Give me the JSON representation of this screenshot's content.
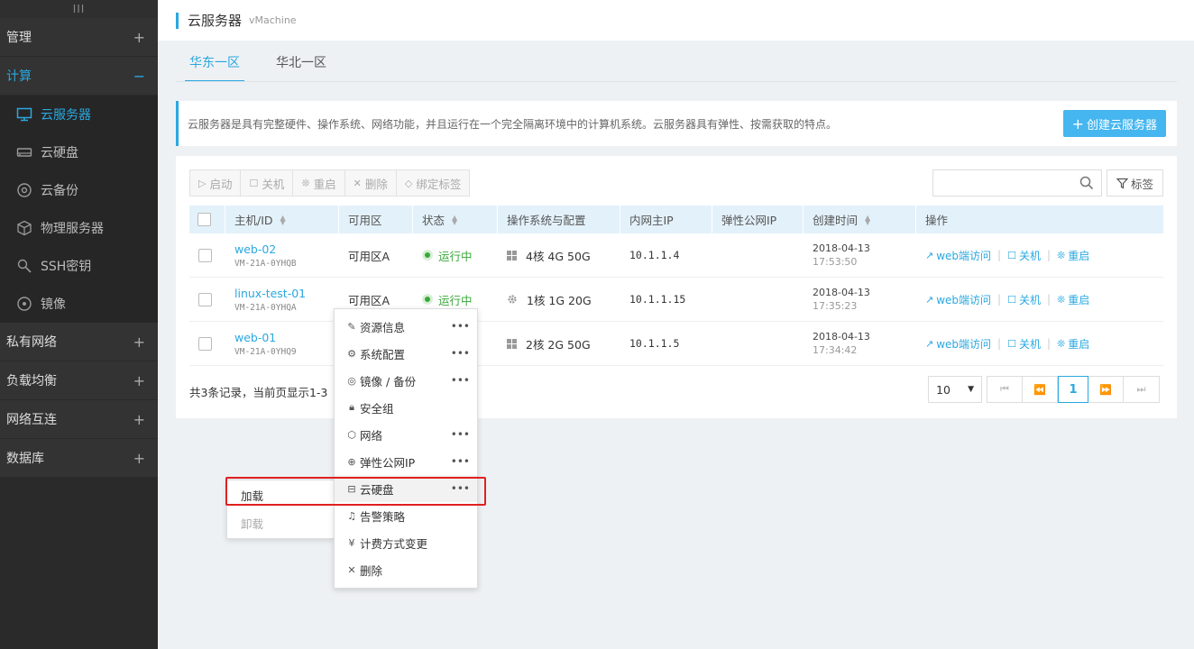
{
  "sidebar": {
    "handle": "III",
    "groups": [
      {
        "label": "管理",
        "toggle": "+"
      },
      {
        "label": "计算",
        "toggle": "−"
      },
      {
        "label": "私有网络",
        "toggle": "+"
      },
      {
        "label": "负载均衡",
        "toggle": "+"
      },
      {
        "label": "网络互连",
        "toggle": "+"
      },
      {
        "label": "数据库",
        "toggle": "+"
      }
    ],
    "compute_items": [
      {
        "label": "云服务器",
        "icon": "monitor-icon"
      },
      {
        "label": "云硬盘",
        "icon": "disk-icon"
      },
      {
        "label": "云备份",
        "icon": "backup-icon"
      },
      {
        "label": "物理服务器",
        "icon": "cube-icon"
      },
      {
        "label": "SSH密钥",
        "icon": "key-icon"
      },
      {
        "label": "镜像",
        "icon": "image-icon"
      }
    ]
  },
  "header": {
    "title": "云服务器",
    "subtitle": "vMachine"
  },
  "tabs": [
    {
      "label": "华东一区"
    },
    {
      "label": "华北一区"
    }
  ],
  "notice": {
    "text": "云服务器是具有完整硬件、操作系统、网络功能，并且运行在一个完全隔离环境中的计算机系统。云服务器具有弹性、按需获取的特点。",
    "create_button": "创建云服务器"
  },
  "toolbar": {
    "start": "启动",
    "stop": "关机",
    "restart": "重启",
    "delete": "删除",
    "bind_tag": "绑定标签",
    "tag_button": "标签"
  },
  "table": {
    "headers": {
      "host": "主机/ID",
      "zone": "可用区",
      "status": "状态",
      "os": "操作系统与配置",
      "private_ip": "内网主IP",
      "public_ip": "弹性公网IP",
      "created": "创建时间",
      "actions": "操作"
    },
    "rows": [
      {
        "name": "web-02",
        "id": "VM-21A-0YHQB",
        "zone": "可用区A",
        "status": "运行中",
        "os_icon": "windows-icon",
        "config": "4核 4G 50G",
        "ip": "10.1.1.4",
        "date": "2018-04-13",
        "time": "17:53:50"
      },
      {
        "name": "linux-test-01",
        "id": "VM-21A-0YHQA",
        "zone": "可用区A",
        "status": "运行中",
        "os_icon": "linux-gear-icon",
        "config": "1核 1G 20G",
        "ip": "10.1.1.15",
        "date": "2018-04-13",
        "time": "17:35:23"
      },
      {
        "name": "web-01",
        "id": "VM-21A-0YHQ9",
        "zone": "",
        "status": "",
        "os_icon": "windows-icon",
        "config": "2核 2G 50G",
        "ip": "10.1.1.5",
        "date": "2018-04-13",
        "time": "17:34:42"
      }
    ],
    "actions": {
      "web": "web端访问",
      "shutdown": "关机",
      "restart": "重启"
    }
  },
  "footer": {
    "summary": "共3条记录，当前页显示1-3",
    "page_size": "10",
    "current_page": "1"
  },
  "context_menu": {
    "items": [
      {
        "label": "资源信息",
        "icon": "edit-icon",
        "more": true
      },
      {
        "label": "系统配置",
        "icon": "gear-icon",
        "more": true
      },
      {
        "label": "镜像 / 备份",
        "icon": "image-icon",
        "more": true
      },
      {
        "label": "安全组",
        "icon": "lock-icon",
        "more": false
      },
      {
        "label": "网络",
        "icon": "network-icon",
        "more": true
      },
      {
        "label": "弹性公网IP",
        "icon": "globe-icon",
        "more": true
      },
      {
        "label": "云硬盘",
        "icon": "disk-icon",
        "more": true
      },
      {
        "label": "告警策略",
        "icon": "bell-icon",
        "more": false
      },
      {
        "label": "计费方式变更",
        "icon": "yen-icon",
        "more": false
      },
      {
        "label": "删除",
        "icon": "close-icon",
        "more": false
      }
    ],
    "more_glyph": "•••"
  },
  "submenu": {
    "attach": "加载",
    "detach": "卸载"
  },
  "colors": {
    "accent": "#2aa8e0",
    "running": "#3aa83a",
    "highlight": "#e02020",
    "sidebar_bg": "#2a2a2a"
  }
}
